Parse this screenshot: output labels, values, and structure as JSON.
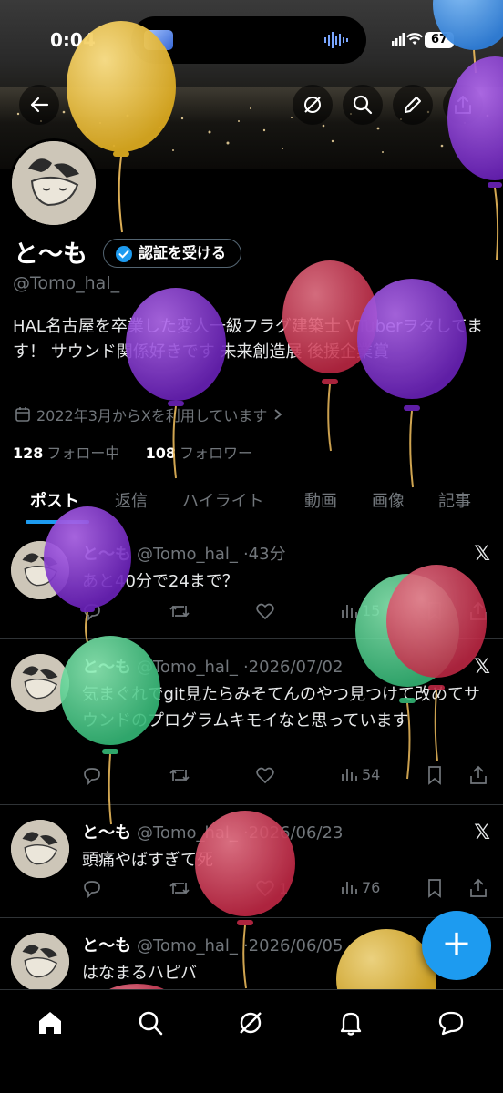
{
  "status_bar": {
    "time": "0:04",
    "battery": "67"
  },
  "profile": {
    "name": "と〜も",
    "verify_button": "認証を受ける",
    "handle": "@Tomo_hal_",
    "bio": "HAL名古屋を卒業した変人一級フラグ建築士 VTuberヲタしてます！ サウンド関係好きです 未来創造展 後援企業賞",
    "joined": "2022年3月からXを利用しています",
    "following_count": "128",
    "following_label": "フォロー中",
    "followers_count": "108",
    "followers_label": "フォロワー"
  },
  "tabs": [
    "ポスト",
    "返信",
    "ハイライト",
    "動画",
    "画像",
    "記事"
  ],
  "posts": [
    {
      "name": "と〜も",
      "handle": "@Tomo_hal_",
      "time": "43分",
      "text": "あと40分で24まで？",
      "views": "15"
    },
    {
      "name": "と〜も",
      "handle": "@Tomo_hal_",
      "time": "2026/07/02",
      "text": "気まぐれでgit見たらみそてんのやつ見つけて改めてサウンドのプログラムキモイなと思っています",
      "views": "54"
    },
    {
      "name": "と〜も",
      "handle": "@Tomo_hal_",
      "time": "2026/06/23",
      "text": "頭痛やばすぎて死",
      "likes": "1",
      "views": "76"
    },
    {
      "name": "と〜も",
      "handle": "@Tomo_hal_",
      "time": "2026/06/05",
      "text": "はなまるハピバ"
    }
  ],
  "fab_label": "+",
  "icons": {
    "back": "arrow-left-icon",
    "grok": "grok-icon",
    "search": "search-icon",
    "edit": "pencil-icon",
    "share": "share-icon",
    "reply": "reply-icon",
    "repost": "repost-icon",
    "like": "heart-icon",
    "views": "views-icon",
    "bookmark": "bookmark-icon",
    "x": "x-logo-icon",
    "home": "home-icon",
    "notifications": "bell-icon",
    "messages": "message-icon"
  },
  "colors": {
    "accent": "#1d9bf0",
    "background": "#000000",
    "muted": "#71767b"
  }
}
